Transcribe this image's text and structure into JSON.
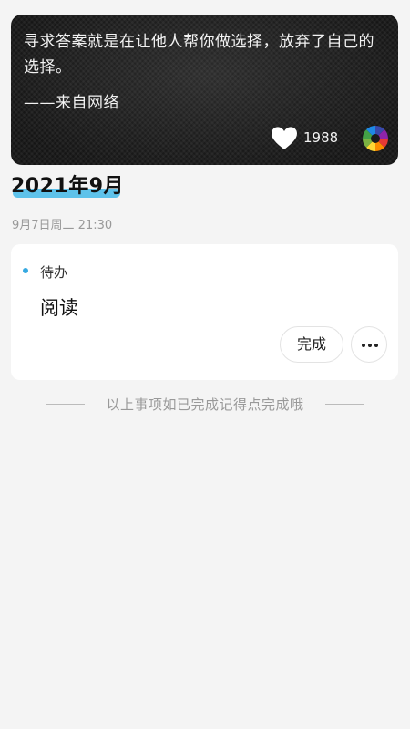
{
  "quote": {
    "text": "寻求答案就是在让他人帮你做选择，放弃了自己的选择。",
    "source": "——来自网络",
    "like_count": "1988",
    "icons": {
      "like": "heart-icon",
      "app": "camera-lens-icon"
    }
  },
  "month_header": {
    "title": "2021年9月",
    "accent_color": "#5ec2ea"
  },
  "entry": {
    "date_time": "9月7日周二 21:30",
    "status": "待办",
    "status_color": "#36a9e1",
    "title": "阅读",
    "done_label": "完成",
    "more_icon": "more-dots-icon"
  },
  "footer": {
    "hint": "以上事项如已完成记得点完成哦"
  }
}
